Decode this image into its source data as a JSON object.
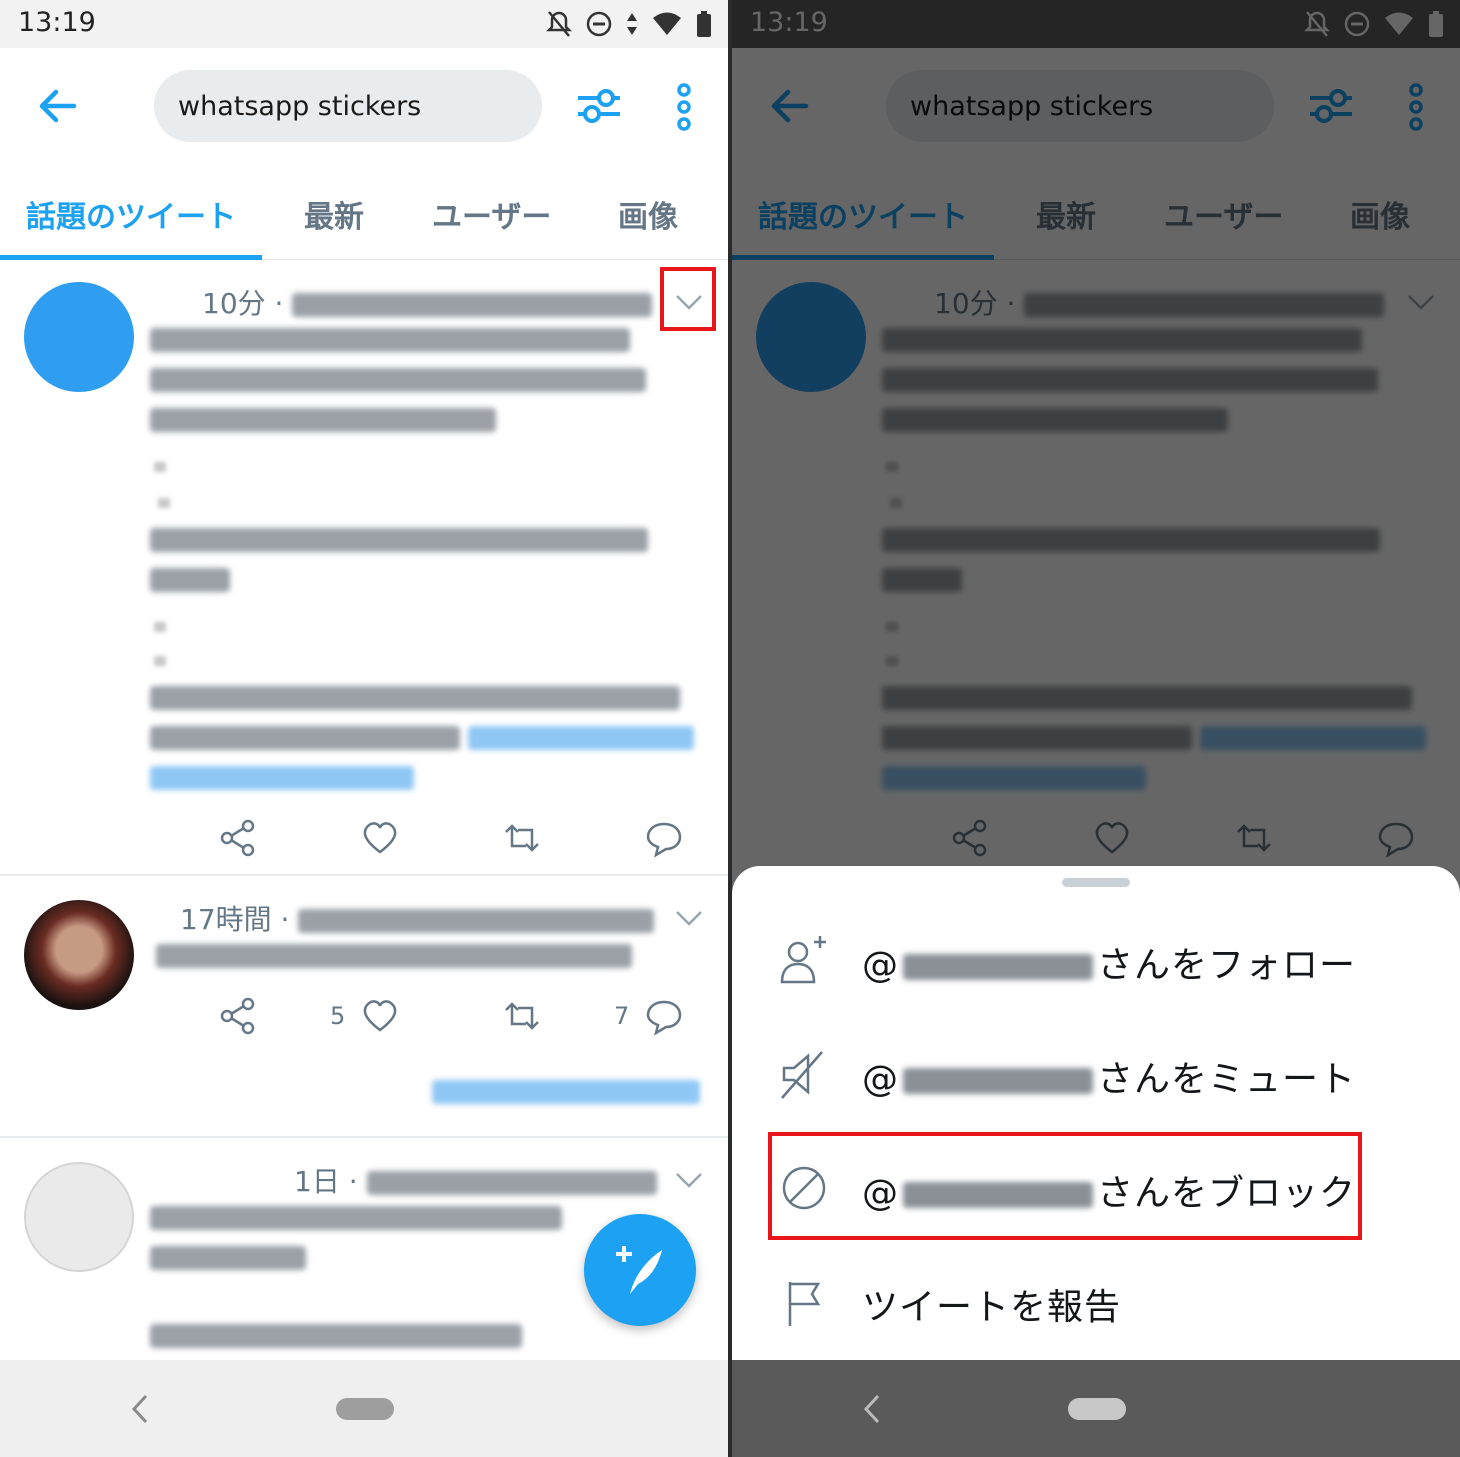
{
  "status": {
    "time": "13:19"
  },
  "search": {
    "query": "whatsapp stickers"
  },
  "tabs": [
    "話題のツイート",
    "最新",
    "ユーザー",
    "画像"
  ],
  "tweets": [
    {
      "time": "10分 ·"
    },
    {
      "time": "17時間 ·",
      "like_count": "5",
      "reply_count": "7"
    },
    {
      "time": "1日 ·"
    }
  ],
  "sheet": {
    "follow_label": "さんをフォロー",
    "mute_label": "さんをミュート",
    "block_label": "さんをブロック",
    "report_label": "ツイートを報告",
    "at_sign": "@"
  },
  "colors": {
    "accent": "#1da1f2",
    "highlight": "#e8151b"
  },
  "icons": [
    "back-arrow-icon",
    "filter-icon",
    "more-vert-icon",
    "chevron-down-icon",
    "share-icon",
    "heart-icon",
    "retweet-icon",
    "reply-icon",
    "compose-icon",
    "follow-icon",
    "mute-icon",
    "block-icon",
    "report-flag-icon"
  ]
}
